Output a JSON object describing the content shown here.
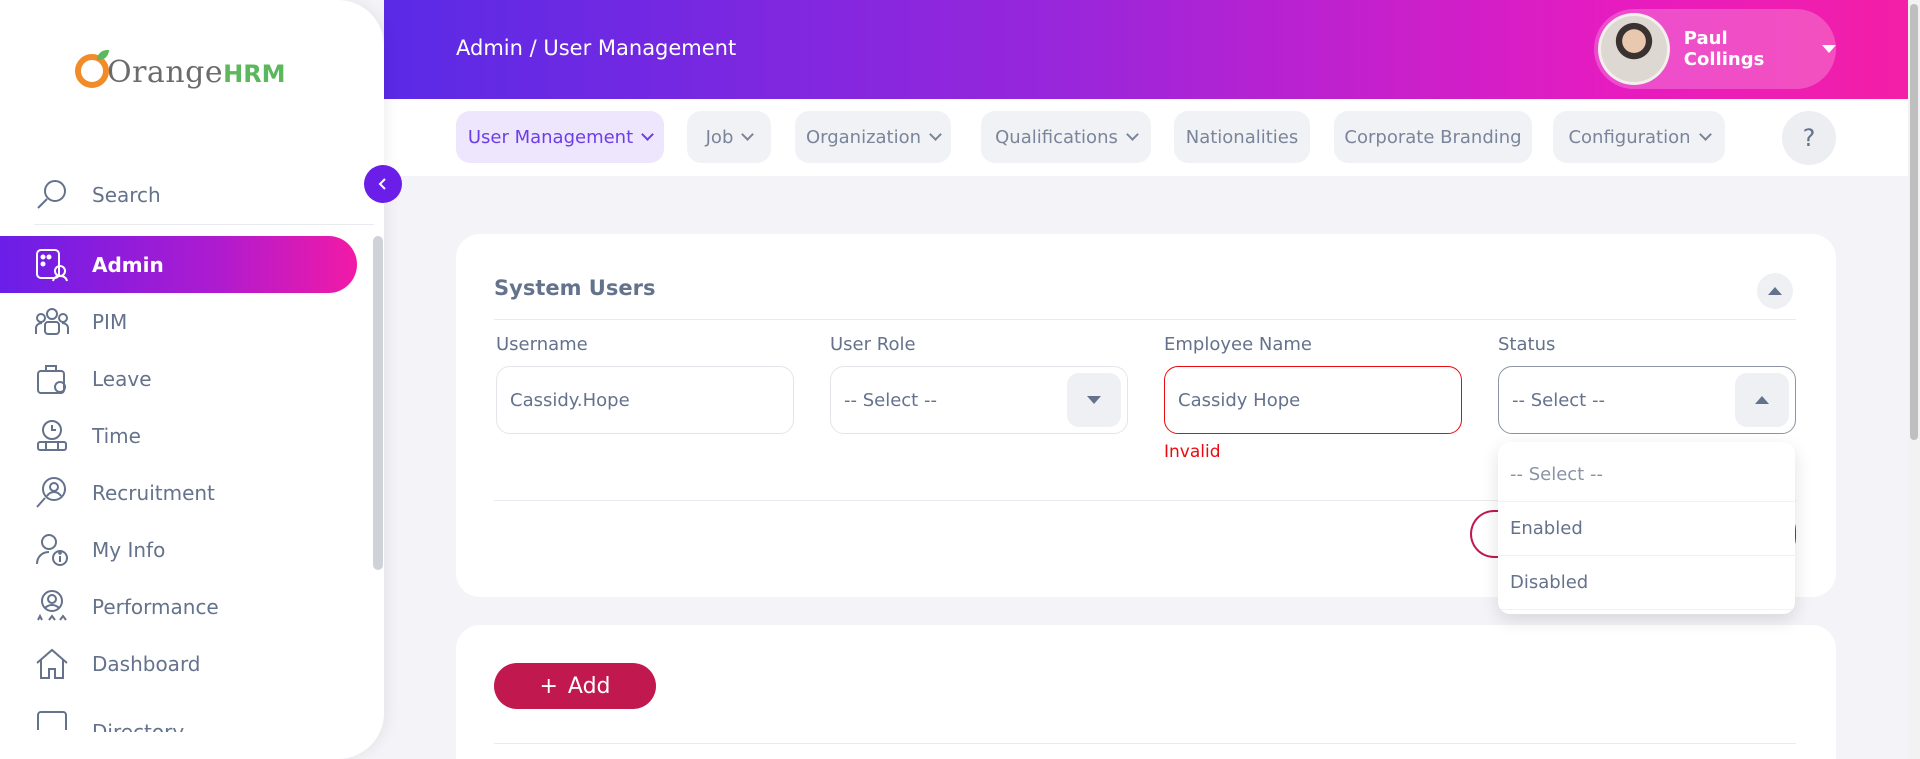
{
  "app": {
    "logo_text_main": "Orange",
    "logo_text_brand": "HRM",
    "brand_colors": {
      "gradient_start": "#5a2ae6",
      "gradient_end": "#f41fa6",
      "accent": "#c0184f",
      "error": "#eb0910"
    }
  },
  "sidebar": {
    "search_label": "Search",
    "items": [
      {
        "label": "Admin",
        "icon": "admin-icon",
        "active": true
      },
      {
        "label": "PIM",
        "icon": "pim-icon"
      },
      {
        "label": "Leave",
        "icon": "leave-icon"
      },
      {
        "label": "Time",
        "icon": "time-icon"
      },
      {
        "label": "Recruitment",
        "icon": "recruitment-icon"
      },
      {
        "label": "My Info",
        "icon": "my-info-icon"
      },
      {
        "label": "Performance",
        "icon": "performance-icon"
      },
      {
        "label": "Dashboard",
        "icon": "dashboard-icon"
      },
      {
        "label": "Directory",
        "icon": "directory-icon"
      }
    ]
  },
  "header": {
    "breadcrumb": "Admin / User Management",
    "user_name": "Paul Collings"
  },
  "tabs": [
    {
      "label": "User Management",
      "active": true,
      "dropdown": true
    },
    {
      "label": "Job",
      "dropdown": true
    },
    {
      "label": "Organization",
      "dropdown": true
    },
    {
      "label": "Qualifications",
      "dropdown": true
    },
    {
      "label": "Nationalities",
      "dropdown": false
    },
    {
      "label": "Corporate Branding",
      "dropdown": false
    },
    {
      "label": "Configuration",
      "dropdown": true
    }
  ],
  "help_label": "?",
  "filter": {
    "title": "System Users",
    "username": {
      "label": "Username",
      "value": "Cassidy.Hope"
    },
    "user_role": {
      "label": "User Role",
      "value": "-- Select --"
    },
    "employee_name": {
      "label": "Employee Name",
      "value": "Cassidy Hope",
      "error": "Invalid"
    },
    "status": {
      "label": "Status",
      "value": "-- Select --",
      "options": [
        "-- Select --",
        "Enabled",
        "Disabled"
      ]
    }
  },
  "records": {
    "add_label": "Add",
    "add_icon": "plus-icon"
  }
}
